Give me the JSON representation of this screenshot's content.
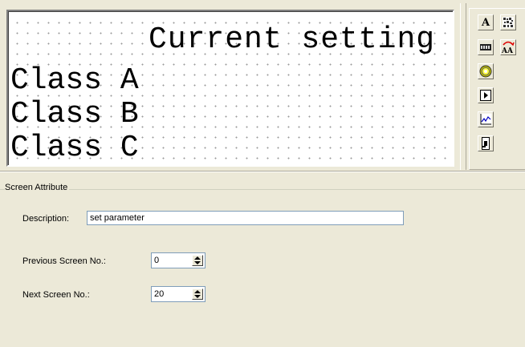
{
  "screen_preview": {
    "title_line": "Current setting",
    "rows": [
      "Class A",
      "Class B",
      "Class C"
    ]
  },
  "toolbox": {
    "tools": [
      {
        "name": "text-tool",
        "label": "A"
      },
      {
        "name": "bitmap-tool"
      },
      {
        "name": "numeric-tool"
      },
      {
        "name": "ascii-tool",
        "label": "AA"
      },
      {
        "name": "lamp-tool"
      },
      {
        "name": "button-tool"
      },
      {
        "name": "trend-graph-tool"
      },
      {
        "name": "screen-jump-tool"
      }
    ]
  },
  "screen_attribute": {
    "group_title": "Screen Attribute",
    "description_label": "Description:",
    "description_value": "set parameter",
    "previous_label": "Previous Screen No.:",
    "previous_value": "0",
    "next_label": "Next Screen No.:",
    "next_value": "20"
  },
  "colors": {
    "window_bg": "#ECE9D8",
    "input_border": "#7F9DB9",
    "lcd_dot": "#9a9a9a"
  }
}
